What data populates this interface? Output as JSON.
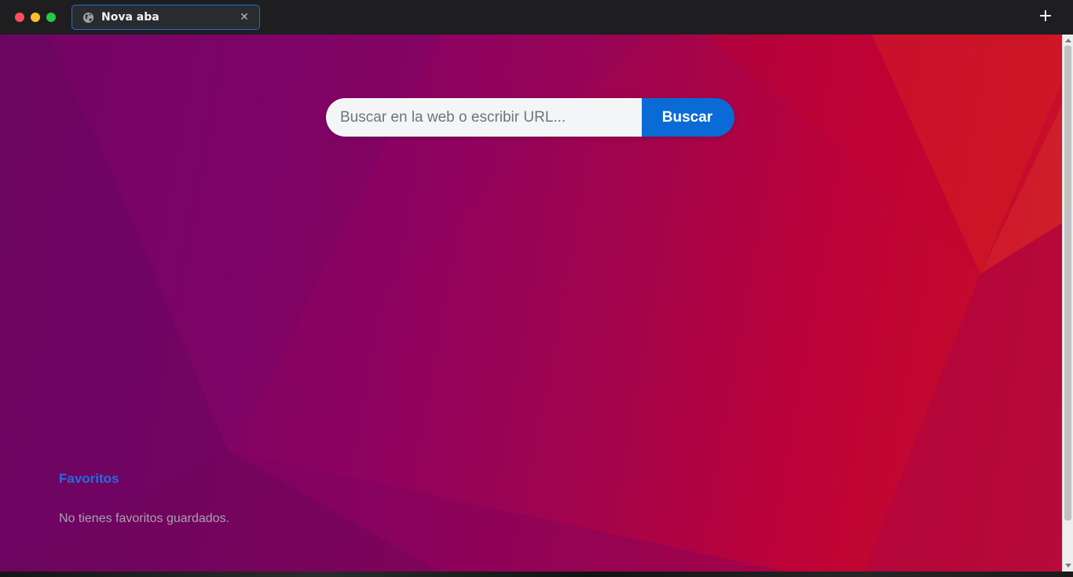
{
  "window": {
    "controls": {
      "close_color": "#ff4d5e",
      "minimize_color": "#ffbd2e",
      "maximize_color": "#28c840"
    }
  },
  "tab": {
    "title": "Nova aba",
    "icon": "globe-icon",
    "close_glyph": "✕"
  },
  "new_tab": {
    "glyph": "+"
  },
  "search": {
    "placeholder": "Buscar en la web o escribir URL...",
    "value": "",
    "button_label": "Buscar"
  },
  "favorites": {
    "title": "Favoritos",
    "empty_message": "No tienes favoritos guardados."
  },
  "colors": {
    "accent": "#0a6bd6",
    "favorites_title": "#1f6fe0",
    "tab_border": "#1f6fd4"
  }
}
